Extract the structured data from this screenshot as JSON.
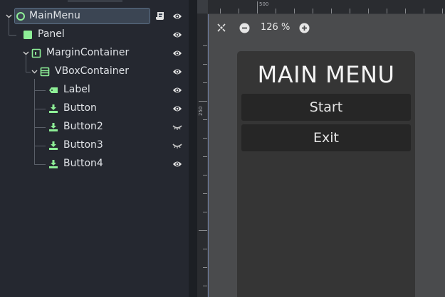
{
  "scene_tree": {
    "nodes": [
      {
        "label": "MainMenu",
        "type": "control-root",
        "visible": true,
        "has_script": true,
        "selected": true
      },
      {
        "label": "Panel",
        "type": "panel",
        "visible": true
      },
      {
        "label": "MarginContainer",
        "type": "margin-container",
        "visible": true
      },
      {
        "label": "VBoxContainer",
        "type": "vbox-container",
        "visible": true
      },
      {
        "label": "Label",
        "type": "label",
        "visible": true
      },
      {
        "label": "Button",
        "type": "button",
        "visible": true
      },
      {
        "label": "Button2",
        "type": "button",
        "visible": false
      },
      {
        "label": "Button3",
        "type": "button",
        "visible": false
      },
      {
        "label": "Button4",
        "type": "button",
        "visible": true
      }
    ],
    "icon_color": "#8eef97"
  },
  "viewport": {
    "zoom_label": "126 %",
    "ruler": {
      "h_mark": "500",
      "v_mark": "250"
    },
    "icons": {
      "center": "center-view-icon",
      "zoom_out": "zoom-out-icon",
      "zoom_in": "zoom-in-icon"
    }
  },
  "game_ui": {
    "title": "MAIN MENU",
    "buttons": [
      "Start",
      "Exit"
    ]
  }
}
